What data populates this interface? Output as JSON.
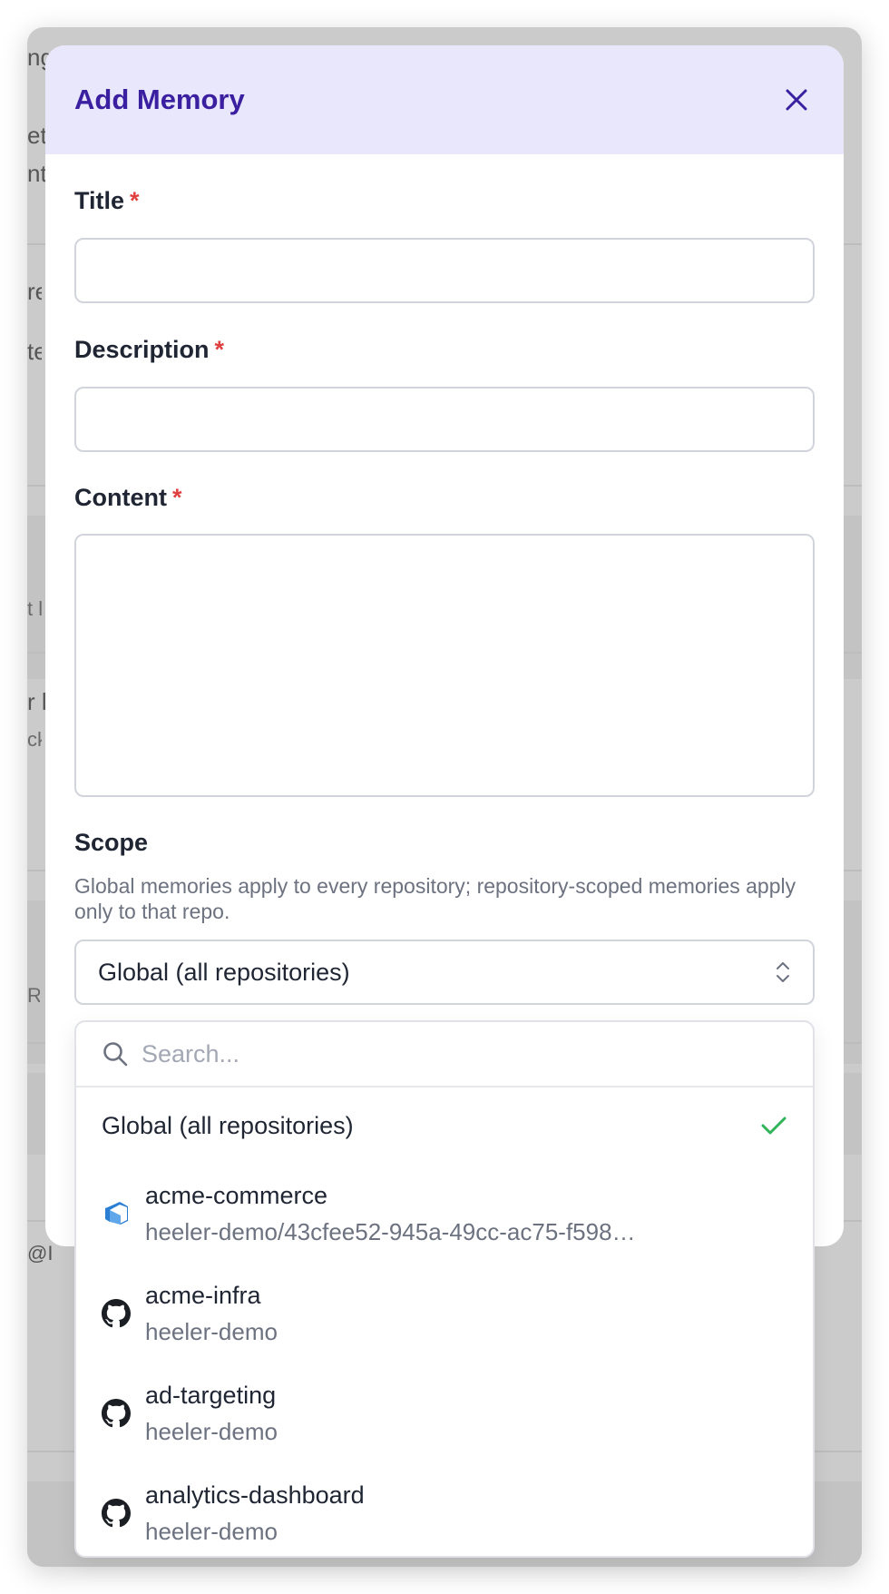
{
  "background": {
    "fragments": [
      "ng",
      "et",
      "nte",
      "re",
      "ten",
      "t l",
      "r l",
      "ck",
      "R",
      "@I"
    ]
  },
  "modal": {
    "title": "Add Memory",
    "fields": {
      "title": {
        "label": "Title",
        "required_mark": "*",
        "value": ""
      },
      "description": {
        "label": "Description",
        "required_mark": "*",
        "value": ""
      },
      "content": {
        "label": "Content",
        "required_mark": "*",
        "value": ""
      }
    },
    "scope": {
      "label": "Scope",
      "help": "Global memories apply to every repository; repository-scoped memories apply only to that repo.",
      "selected": "Global (all repositories)"
    }
  },
  "dropdown": {
    "search_placeholder": "Search...",
    "global_option": "Global (all repositories)",
    "options": [
      {
        "name": "acme-commerce",
        "sub": "heeler-demo/43cfee52-945a-49cc-ac75-f598…",
        "icon": "azure-devops-icon"
      },
      {
        "name": "acme-infra",
        "sub": "heeler-demo",
        "icon": "github-icon"
      },
      {
        "name": "ad-targeting",
        "sub": "heeler-demo",
        "icon": "github-icon"
      },
      {
        "name": "analytics-dashboard",
        "sub": "heeler-demo",
        "icon": "github-icon"
      }
    ]
  },
  "colors": {
    "accent": "#3a1fa0",
    "header_bg": "#e8e7fb",
    "required": "#e0403f",
    "check": "#2fb45a",
    "azure": "#2a7fd4"
  }
}
